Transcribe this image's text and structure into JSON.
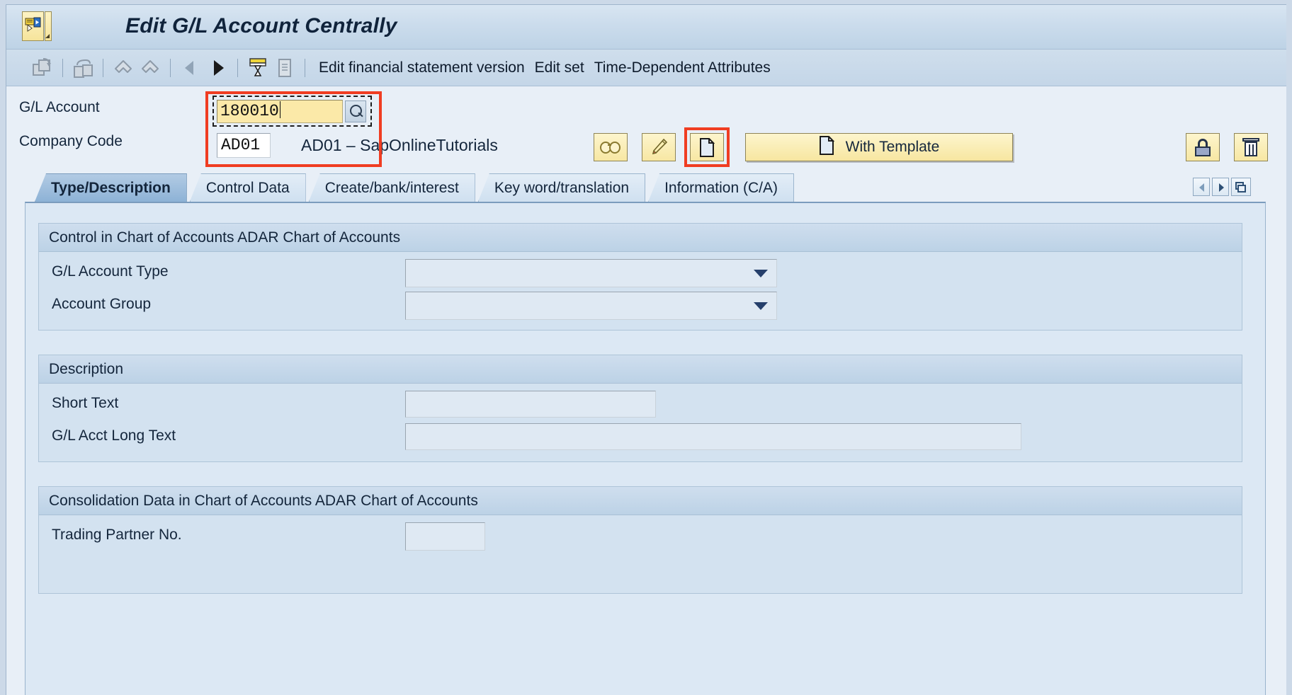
{
  "window": {
    "title": "Edit G/L Account Centrally",
    "menu_icon": "sap-menu-icon",
    "menu_arrow_icon": "chevron-down-icon"
  },
  "toolbar": {
    "icons": [
      {
        "name": "copy-icon"
      },
      {
        "name": "copy-link-icon"
      },
      {
        "name": "undo-icon"
      },
      {
        "name": "redo-icon"
      },
      {
        "name": "previous-arrow-icon"
      },
      {
        "name": "next-arrow-icon"
      },
      {
        "name": "hourglass-print-icon"
      },
      {
        "name": "document-list-icon"
      }
    ],
    "menu_items": [
      "Edit financial statement version",
      "Edit set",
      "Time-Dependent Attributes"
    ]
  },
  "header": {
    "gl_account_label": "G/L Account",
    "gl_account_value": "180010",
    "gl_account_placeholder": "",
    "gl_search_help_icon": "search-help-icon",
    "company_code_label": "Company Code",
    "company_code_value": "AD01",
    "company_code_description": "AD01 – SapOnlineTutorials",
    "buttons": {
      "display": {
        "name": "display-button",
        "icon": "glasses-icon",
        "label": ""
      },
      "change": {
        "name": "change-button",
        "icon": "pencil-icon",
        "label": ""
      },
      "create": {
        "name": "create-button",
        "icon": "document-icon",
        "label": ""
      },
      "with_template": {
        "name": "with-template-button",
        "icon": "document-icon",
        "label": "With Template"
      },
      "lock": {
        "name": "lock-button",
        "icon": "lock-icon",
        "label": ""
      },
      "delete": {
        "name": "delete-button",
        "icon": "trash-icon",
        "label": ""
      }
    },
    "highlight_color": "#f03d22"
  },
  "tabs": {
    "items": [
      {
        "label": "Type/Description",
        "active": true
      },
      {
        "label": "Control Data",
        "active": false
      },
      {
        "label": "Create/bank/interest",
        "active": false
      },
      {
        "label": "Key word/translation",
        "active": false
      },
      {
        "label": "Information (C/A)",
        "active": false
      }
    ],
    "nav": {
      "prev_icon": "tab-scroll-left-icon",
      "next_icon": "tab-scroll-right-icon",
      "list_icon": "tab-list-icon"
    }
  },
  "groups": [
    {
      "title": "Control in Chart of Accounts ADAR Chart of Accounts",
      "fields": [
        {
          "label": "G/L Account Type",
          "value": "",
          "type": "dropdown"
        },
        {
          "label": "Account Group",
          "value": "",
          "type": "dropdown"
        }
      ]
    },
    {
      "title": "Description",
      "fields": [
        {
          "label": "Short Text",
          "value": "",
          "type": "text"
        },
        {
          "label": "G/L Acct Long Text",
          "value": "",
          "type": "text"
        }
      ]
    },
    {
      "title": "Consolidation Data in Chart of Accounts ADAR Chart of Accounts",
      "fields": [
        {
          "label": "Trading Partner No.",
          "value": "",
          "type": "text"
        }
      ]
    }
  ]
}
